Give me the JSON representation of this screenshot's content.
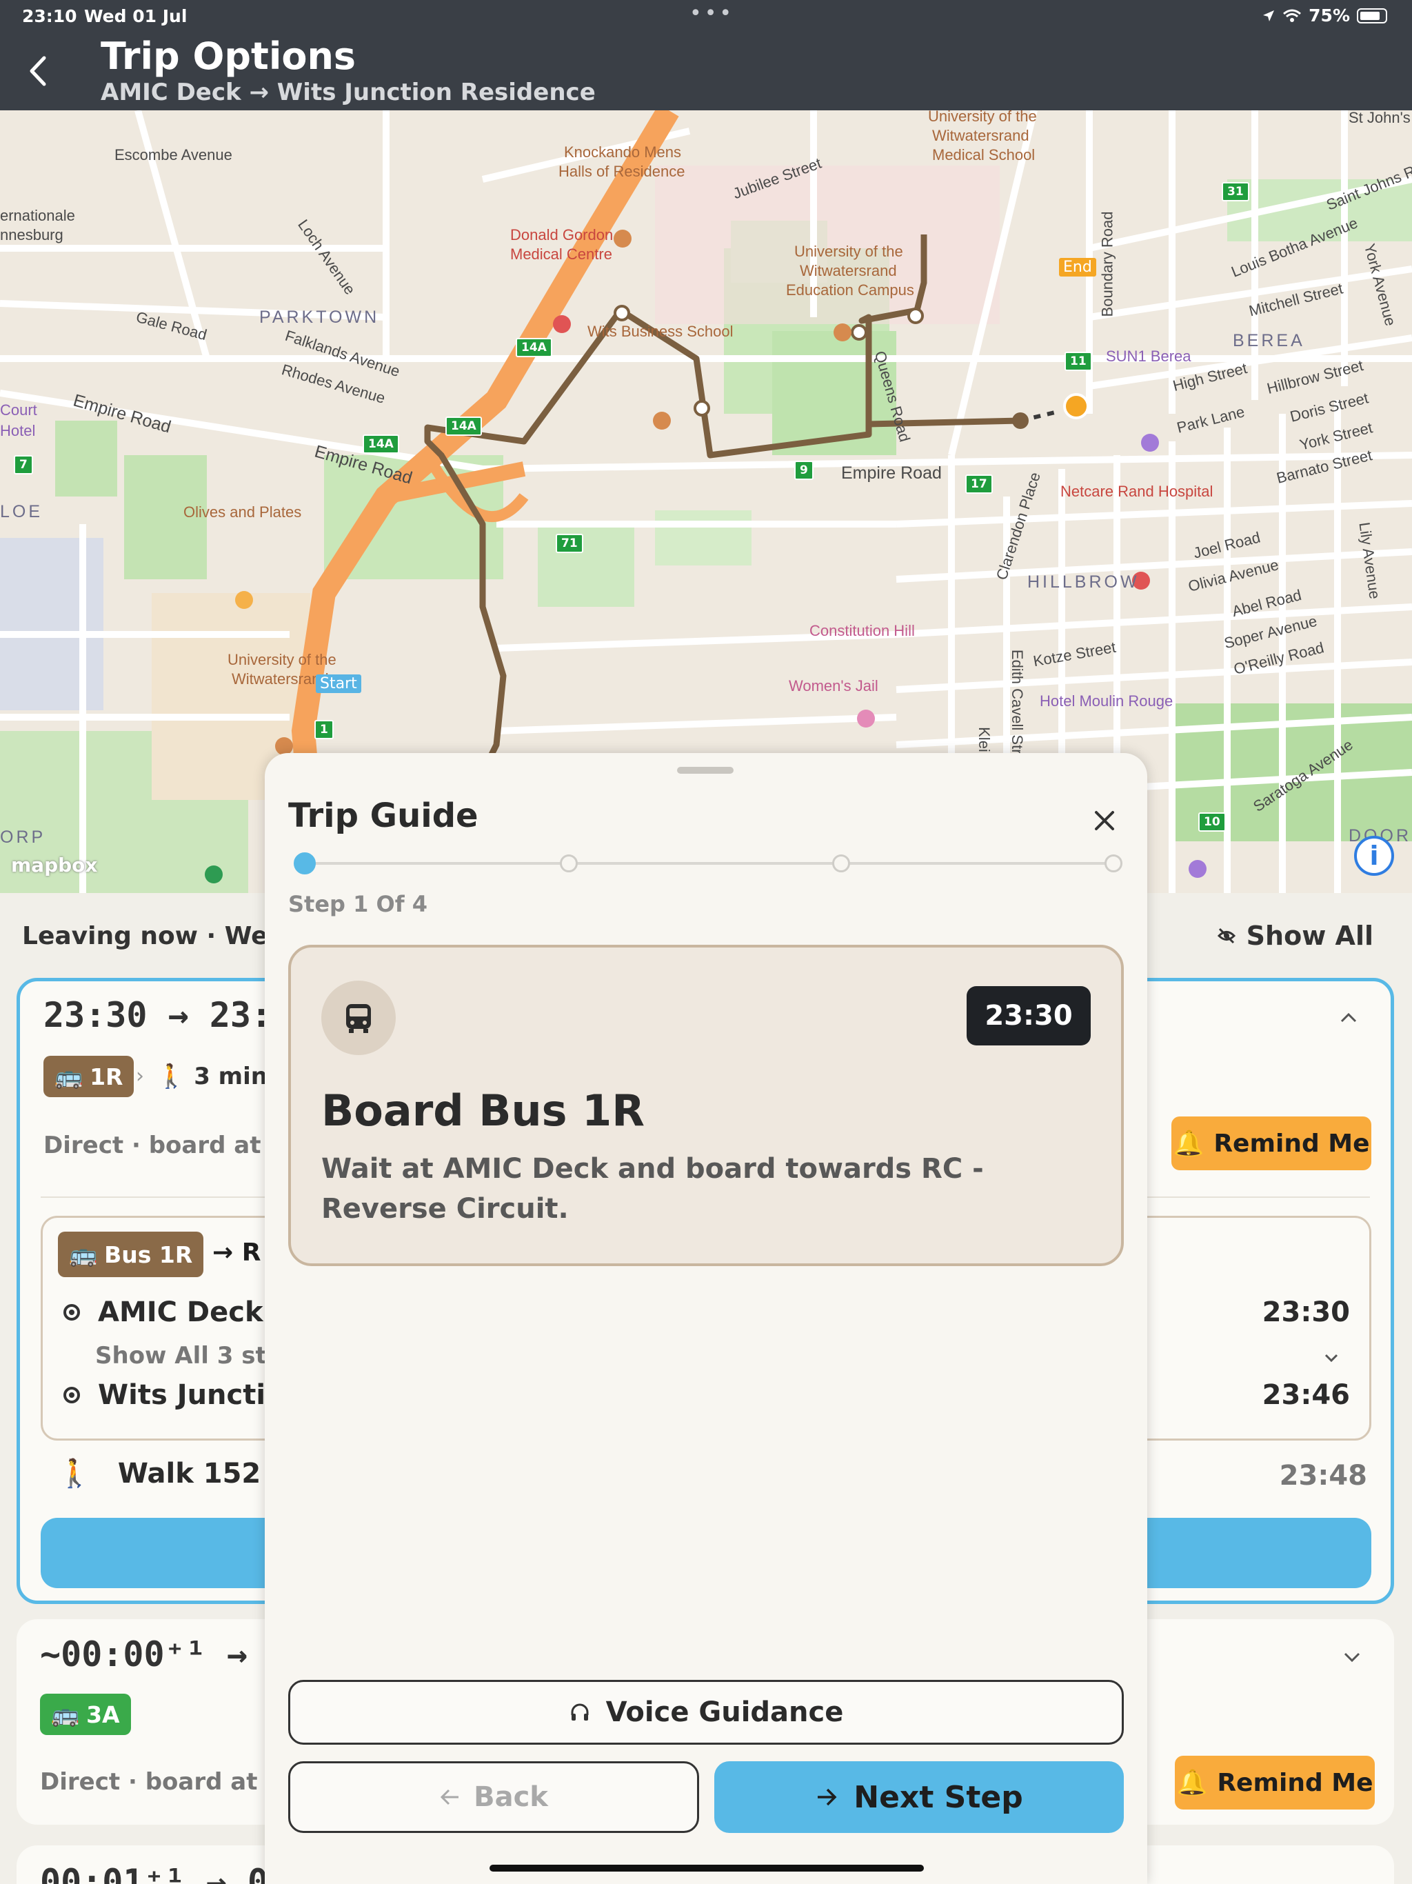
{
  "status_bar": {
    "time": "23:10",
    "date": "Wed 01 Jul",
    "battery": "75%"
  },
  "header": {
    "title": "Trip Options",
    "subtitle": "AMIC Deck → Wits Junction Residence"
  },
  "map": {
    "labels": {
      "escombe": "Escombe Avenue",
      "international": "ernationale",
      "johannesburg": "nnesburg",
      "knockando": "Knockando Mens",
      "halls": "Halls of Residence",
      "uni_wits_med1": "University of the",
      "uni_wits_med2": "Witwatersrand",
      "uni_wits_med3": "Medical School",
      "st_johns": "St John's",
      "jubilee": "Jubilee Street",
      "saint_johns_rd": "Saint Johns R",
      "donald": "Donald Gordon",
      "medical_centre": "Medical Centre",
      "uni_edu1": "University of the",
      "uni_edu2": "Witwatersrand",
      "uni_edu3": "Education Campus",
      "boundary": "Boundary Road",
      "louis_botha": "Louis Botha Avenue",
      "york_ave": "York Avenue",
      "loch": "Loch Avenue",
      "gale": "Gale Road",
      "parktown": "PARKTOWN",
      "falklands": "Falklands Avenue",
      "rhodes": "Rhodes Avenue",
      "wits_business": "Wits Business School",
      "mitchell": "Mitchell Street",
      "berea": "BEREA",
      "sun1": "SUN1 Berea",
      "high_street": "High Street",
      "hillbrow_st": "Hillbrow Street",
      "court": "Court",
      "hotel": "Hotel",
      "empire1": "Empire Road",
      "empire2": "Empire Road",
      "empire3": "Empire Road",
      "queens": "Queens Road",
      "doris": "Doris Street",
      "park_lane": "Park Lane",
      "york_st": "York Street",
      "barnato": "Barnato Street",
      "olives": "Olives and Plates",
      "clarendon": "Clarendon Place",
      "netcare": "Netcare Rand Hospital",
      "loe": "LOE",
      "joel": "Joel Road",
      "olivia": "Olivia Avenue",
      "lily": "Lily Avenue",
      "hillbrow": "HILLBROW",
      "abel": "Abel Road",
      "soper": "Soper Avenue",
      "constitution": "Constitution Hill",
      "edith": "Edith Cavell Street",
      "kotze": "Kotze Street",
      "oreilly": "O'Reilly Road",
      "uni_main1": "University of the",
      "uni_main2": "Witwatersrand",
      "womens_jail": "Women's Jail",
      "klein": "Klein Street",
      "moulin": "Hotel Moulin Rouge",
      "saratoga": "Saratoga Avenue",
      "orp": "ORP",
      "doorn": "DOORI",
      "start": "Start",
      "end": "End",
      "mapbox": "mapbox"
    },
    "route_badges": [
      "31",
      "14A",
      "11",
      "7",
      "14A",
      "14A",
      "9",
      "17",
      "71",
      "10",
      "1"
    ]
  },
  "list": {
    "leaving": "Leaving now · Wed",
    "show_all": "Show All",
    "cards": [
      {
        "times": "23:30 → 23:4",
        "bus": "1R",
        "walk": "3 min",
        "direct": "Direct · board at A",
        "remind": "Remind Me",
        "leg_bus": "Bus 1R",
        "leg_dest": "→ R",
        "stop_from": "AMIC Deck",
        "stop_from_time": "23:30",
        "show_stops": "Show All 3 sto",
        "stop_to": "Wits Juncti",
        "stop_to_time": "23:46",
        "walk_leg": "Walk 152 m",
        "walk_leg_time": "23:48"
      },
      {
        "times": "~00:00⁺¹ → ~",
        "bus": "3A",
        "direct": "Direct · board at A",
        "remind": "Remind Me"
      },
      {
        "times": "00:01⁺¹ → 00:"
      }
    ]
  },
  "sheet": {
    "title": "Trip Guide",
    "step_label": "Step 1 Of 4",
    "step_current": 1,
    "step_total": 4,
    "time": "23:30",
    "heading": "Board Bus 1R",
    "description": "Wait at AMIC Deck and board towards RC - Reverse Circuit.",
    "voice": "Voice Guidance",
    "back": "Back",
    "next": "Next Step"
  },
  "colors": {
    "accent_blue": "#58b9e6",
    "route_brown": "#8a6a48",
    "remind_orange": "#f9ab3c",
    "bus_green": "#3aaa4a",
    "header_dark": "#3a3f46"
  }
}
